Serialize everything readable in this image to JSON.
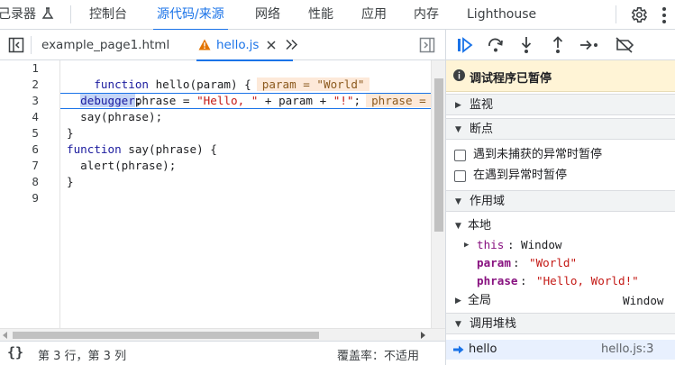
{
  "top_tabs": [
    {
      "label": "记录器 ⁄⁄",
      "active": false
    },
    {
      "label": "控制台",
      "active": false
    },
    {
      "label": "源代码/来源",
      "active": true
    },
    {
      "label": "网络",
      "active": false
    },
    {
      "label": "性能",
      "active": false
    },
    {
      "label": "应用",
      "active": false
    },
    {
      "label": "内存",
      "active": false
    },
    {
      "label": "Lighthouse",
      "active": false
    }
  ],
  "recorder_label": "己录器",
  "file_tabs": [
    {
      "label": "example_page1.html",
      "active": false
    },
    {
      "label": "hello.js",
      "active": true,
      "warning": true
    }
  ],
  "code": {
    "line_numbers": [
      "1",
      "2",
      "3",
      "4",
      "5",
      "6",
      "7",
      "8",
      "9"
    ],
    "lines": [
      "function hello(param) {",
      "  let phrase = \"Hello, \" + param + \"!\";",
      "  debugger;",
      "  say(phrase);",
      "}",
      "function say(phrase) {",
      "  alert(phrase);",
      "}",
      ""
    ],
    "inline_values": {
      "line1": "param = \"World\"",
      "line2": "phrase = "
    },
    "current_line": 3
  },
  "status": {
    "position": "第 3 行，第 3 列",
    "coverage": "覆盖率：不适用"
  },
  "debugger": {
    "paused_message": "调试程序已暂停",
    "sections": {
      "watch": "监视",
      "breakpoints": "断点",
      "scope": "作用域",
      "call_stack": "调用堆栈"
    },
    "breakpoint_options": [
      "遇到未捕获的异常时暂停",
      "在遇到异常时暂停"
    ],
    "scope": {
      "local_label": "本地",
      "this_name": "this",
      "this_value": "Window",
      "param_name": "param",
      "param_value": "\"World\"",
      "phrase_name": "phrase",
      "phrase_value": "\"Hello, World!\"",
      "global_label": "全局",
      "global_value": "Window"
    },
    "call_stack": [
      {
        "name": "hello",
        "location": "hello.js:3"
      }
    ]
  },
  "colors": {
    "accent": "#1a73e8",
    "paused_bg": "#fff4d6",
    "inline_value_bg": "#fde9d9"
  }
}
